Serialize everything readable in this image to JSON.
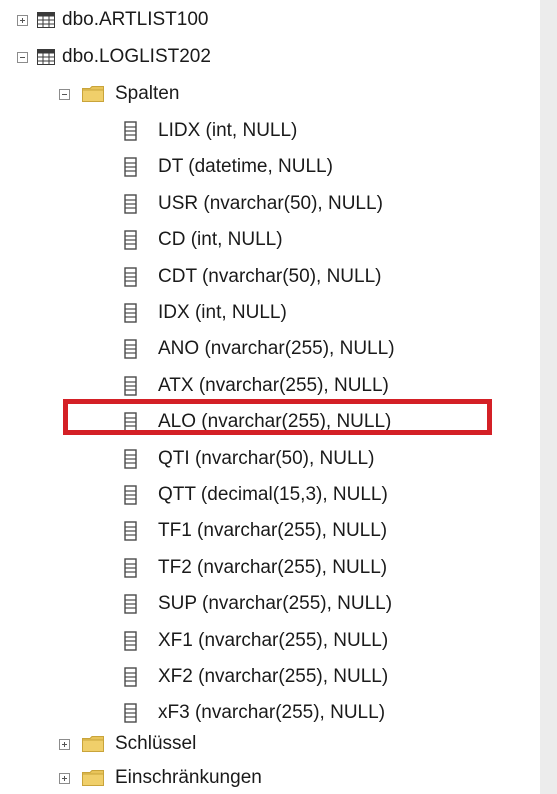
{
  "tree": {
    "tables": [
      {
        "label": "dbo.ARTLIST100",
        "icon": "table-icon",
        "state": "collapsed"
      },
      {
        "label": "dbo.LOGLIST202",
        "icon": "table-icon",
        "state": "expanded"
      }
    ],
    "columns_folder": {
      "label": "Spalten",
      "icon": "folder-icon",
      "state": "expanded"
    },
    "columns": [
      {
        "label": "LIDX (int, NULL)"
      },
      {
        "label": "DT (datetime, NULL)"
      },
      {
        "label": "USR (nvarchar(50), NULL)"
      },
      {
        "label": "CD (int, NULL)"
      },
      {
        "label": "CDT (nvarchar(50), NULL)"
      },
      {
        "label": "IDX (int, NULL)"
      },
      {
        "label": "ANO (nvarchar(255), NULL)"
      },
      {
        "label": "ATX (nvarchar(255), NULL)"
      },
      {
        "label": "ALO (nvarchar(255), NULL)",
        "highlighted": true
      },
      {
        "label": "QTI (nvarchar(50), NULL)"
      },
      {
        "label": "QTT (decimal(15,3), NULL)"
      },
      {
        "label": "TF1 (nvarchar(255), NULL)"
      },
      {
        "label": "TF2 (nvarchar(255), NULL)"
      },
      {
        "label": "SUP (nvarchar(255), NULL)"
      },
      {
        "label": "XF1 (nvarchar(255), NULL)"
      },
      {
        "label": "XF2 (nvarchar(255), NULL)"
      },
      {
        "label": "xF3 (nvarchar(255), NULL)"
      }
    ],
    "folders": [
      {
        "label": "Schlüssel",
        "icon": "folder-icon",
        "state": "collapsed"
      },
      {
        "label": "Einschränkungen",
        "icon": "folder-icon",
        "state": "collapsed"
      }
    ]
  },
  "colors": {
    "highlight_border": "#d42026",
    "folder": "#e8c45a",
    "scrollbar": "#ececec"
  }
}
